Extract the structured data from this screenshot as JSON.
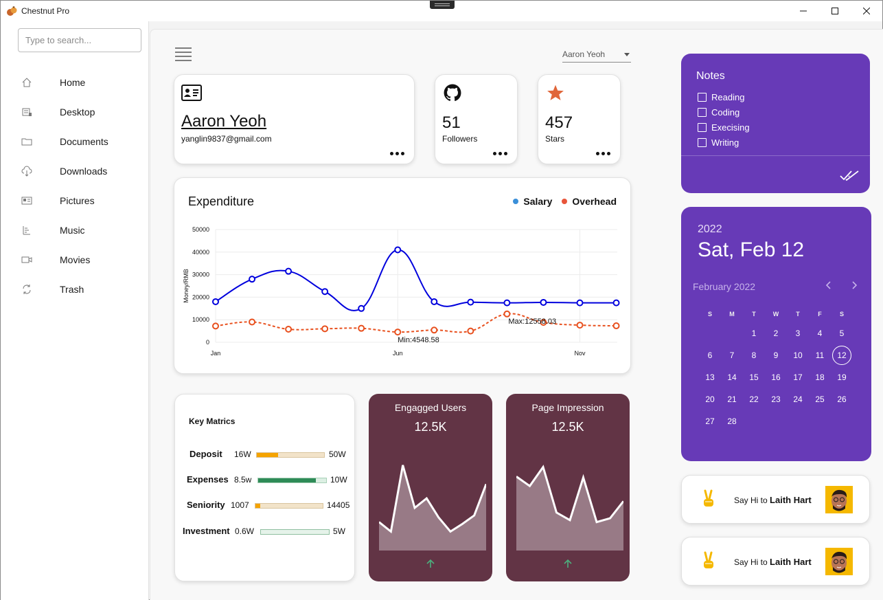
{
  "app": {
    "title": "Chestnut Pro"
  },
  "search": {
    "placeholder": "Type to search..."
  },
  "sidebar": {
    "items": [
      {
        "label": "Home",
        "icon": "home-icon"
      },
      {
        "label": "Desktop",
        "icon": "desktop-icon"
      },
      {
        "label": "Documents",
        "icon": "folder-icon"
      },
      {
        "label": "Downloads",
        "icon": "cloud-download-icon"
      },
      {
        "label": "Pictures",
        "icon": "picture-icon"
      },
      {
        "label": "Music",
        "icon": "music-icon"
      },
      {
        "label": "Movies",
        "icon": "video-icon"
      },
      {
        "label": "Trash",
        "icon": "sync-icon"
      }
    ]
  },
  "header": {
    "user_select": "Aaron Yeoh"
  },
  "profile": {
    "name": "Aaron Yeoh",
    "email": "yanglin9837@gmail.com"
  },
  "followers": {
    "value": "51",
    "label": "Followers"
  },
  "stars": {
    "value": "457",
    "label": "Stars"
  },
  "expenditure": {
    "title": "Expenditure",
    "legend": [
      {
        "name": "Salary",
        "color": "#3a8fd9"
      },
      {
        "name": "Overhead",
        "color": "#e8553a"
      }
    ]
  },
  "chart_data": {
    "type": "line",
    "title": "Expenditure",
    "ylabel": "Money/RMB",
    "xlabel": "",
    "ylim": [
      0,
      50000
    ],
    "yticks": [
      "0",
      "10000",
      "20000",
      "30000",
      "40000",
      "50000"
    ],
    "xticks": [
      {
        "label": "Jan",
        "index": 0
      },
      {
        "label": "Jun",
        "index": 5
      },
      {
        "label": "Nov",
        "index": 10
      }
    ],
    "x": [
      0,
      1,
      2,
      3,
      4,
      5,
      6,
      7,
      8,
      9,
      10,
      11
    ],
    "series": [
      {
        "name": "Salary",
        "color": "#0000dd",
        "style": "solid",
        "values": [
          18000,
          28000,
          31500,
          22500,
          15000,
          41000,
          18000,
          17800,
          17500,
          17700,
          17500,
          17500
        ]
      },
      {
        "name": "Overhead",
        "color": "#e8501e",
        "style": "dashed",
        "values": [
          7200,
          9000,
          5800,
          6000,
          6200,
          4548.58,
          5400,
          5000,
          12558.03,
          8800,
          7600,
          7300
        ]
      }
    ],
    "annotations": [
      {
        "text": "Max:12558.03",
        "series": "Overhead",
        "index": 8
      },
      {
        "text": "Min:4548.58",
        "series": "Overhead",
        "index": 5
      }
    ]
  },
  "key_metrics": {
    "title": "Key Matrics",
    "rows": [
      {
        "label": "Deposit",
        "value": "16W",
        "max": "50W",
        "fraction": 0.32,
        "color": "#f5a300"
      },
      {
        "label": "Expenses",
        "value": "8.5w",
        "max": "10W",
        "fraction": 0.85,
        "color": "#2e8b57"
      },
      {
        "label": "Seniority",
        "value": "1007",
        "max": "14405",
        "fraction": 0.07,
        "color": "#f5a300"
      },
      {
        "label": "Investment",
        "value": "0.6W",
        "max": "5W",
        "fraction": 0.0,
        "color": "#2e8b57"
      }
    ]
  },
  "engaged": {
    "title": "Engagged Users",
    "value": "12.5K",
    "trend": [
      30,
      20,
      90,
      45,
      55,
      35,
      20,
      28,
      37,
      70
    ]
  },
  "impression": {
    "title": "Page Impression",
    "value": "12.5K",
    "trend": [
      78,
      68,
      88,
      40,
      32,
      77,
      30,
      34,
      52
    ]
  },
  "notes": {
    "title": "Notes",
    "items": [
      "Reading",
      "Coding",
      "Execising",
      "Writing"
    ]
  },
  "calendar": {
    "year": "2022",
    "date": "Sat, Feb 12",
    "month": "February 2022",
    "weekdays": [
      "S",
      "M",
      "T",
      "W",
      "T",
      "F",
      "S"
    ],
    "first_weekday": 2,
    "days": 28,
    "selected": 12
  },
  "greetings": [
    {
      "prefix": "Say Hi to",
      "name": "Laith Hart"
    },
    {
      "prefix": "Say Hi to",
      "name": "Laith Hart"
    }
  ],
  "colors": {
    "accent": "#673ab7",
    "dark_card": "#623445"
  }
}
